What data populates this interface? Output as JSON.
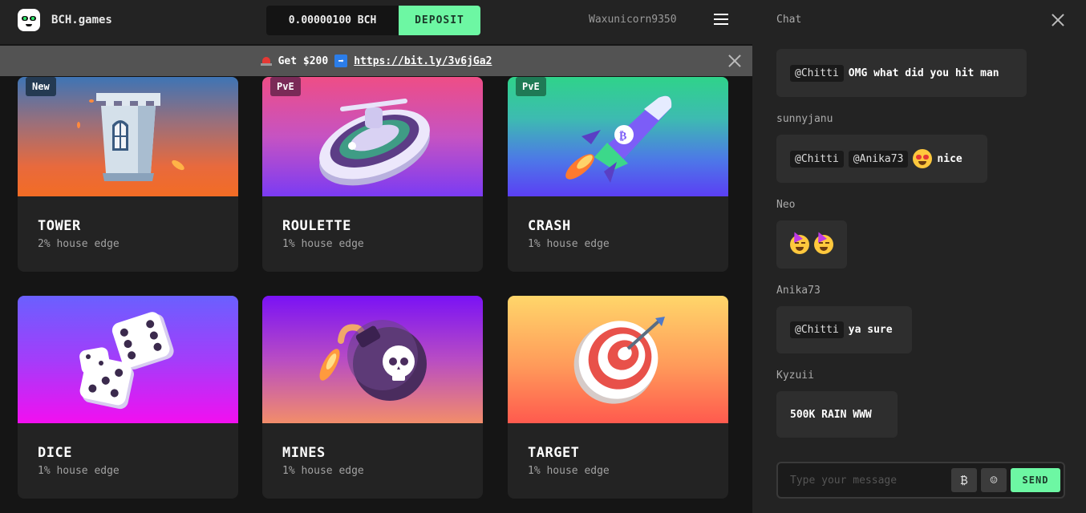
{
  "header": {
    "brand": "BCH.games",
    "balance": "0.00000100 BCH",
    "deposit_label": "DEPOSIT",
    "username": "Waxunicorn9350"
  },
  "promo": {
    "text": "Get $200",
    "link": "https://bit.ly/3v6jGa2"
  },
  "games": [
    {
      "title": "TOWER",
      "edge": "2% house edge",
      "badge": "New"
    },
    {
      "title": "ROULETTE",
      "edge": "1% house edge",
      "badge": "PvE"
    },
    {
      "title": "CRASH",
      "edge": "1% house edge",
      "badge": "PvE"
    },
    {
      "title": "DICE",
      "edge": "1% house edge"
    },
    {
      "title": "MINES",
      "edge": "1% house edge"
    },
    {
      "title": "TARGET",
      "edge": "1% house edge"
    }
  ],
  "chat": {
    "title": "Chat",
    "messages": [
      {
        "mentions": [
          "@Chitti"
        ],
        "text": "OMG what did you hit man"
      },
      {
        "user": "sunnyjanu",
        "mentions": [
          "@Chitti",
          "@Anika73"
        ],
        "text": "nice",
        "emoji": "heart-eyes-emoji"
      },
      {
        "user": "Neo",
        "emoji": "party-face-emoji"
      },
      {
        "user": "Anika73",
        "mentions": [
          "@Chitti"
        ],
        "text": "ya sure"
      },
      {
        "user": "Kyzuii",
        "text": "500K RAIN WWW"
      }
    ],
    "input_placeholder": "Type your message",
    "send_label": "SEND"
  },
  "colors": {
    "accent": "#6df7a3",
    "background": "#151515",
    "panel": "#232323"
  }
}
